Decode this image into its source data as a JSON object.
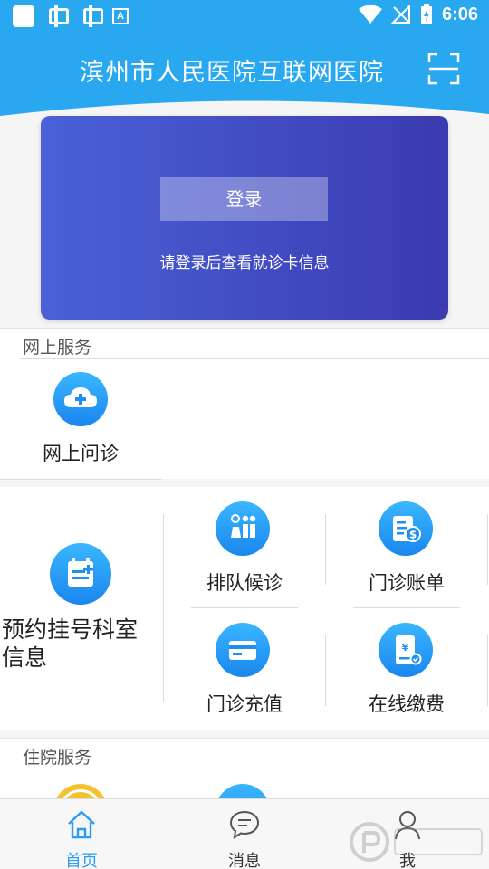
{
  "status_bar": {
    "time": "6:06"
  },
  "header": {
    "title": "滨州市人民医院互联网医院"
  },
  "login_card": {
    "button_label": "登录",
    "hint": "请登录后查看就诊卡信息"
  },
  "online_service": {
    "title": "网上服务",
    "items": [
      {
        "label": "网上问诊",
        "icon": "cloud-plus-icon"
      }
    ]
  },
  "service_grid": {
    "main": {
      "label_line1": "预约挂号科室",
      "label_line2": "信息",
      "icon": "calendar-plus-icon"
    },
    "items": [
      {
        "label": "排队候诊",
        "icon": "queue-waiting-icon"
      },
      {
        "label": "门诊账单",
        "icon": "bill-dollar-icon"
      },
      {
        "label": "门诊充值",
        "icon": "card-recharge-icon"
      },
      {
        "label": "在线缴费",
        "icon": "phone-pay-icon"
      }
    ]
  },
  "inpatient_service": {
    "title": "住院服务"
  },
  "tabbar": {
    "tabs": [
      {
        "label": "首页",
        "icon": "home-icon",
        "active": true
      },
      {
        "label": "消息",
        "icon": "message-icon",
        "active": false
      },
      {
        "label": "我",
        "icon": "person-icon",
        "active": false
      }
    ]
  },
  "colors": {
    "brand": "#29a8f0",
    "accent_blue": "#1a86ee",
    "card_start": "#4a61d8",
    "card_end": "#3b3ab0",
    "tab_active": "#2b9cf2"
  }
}
